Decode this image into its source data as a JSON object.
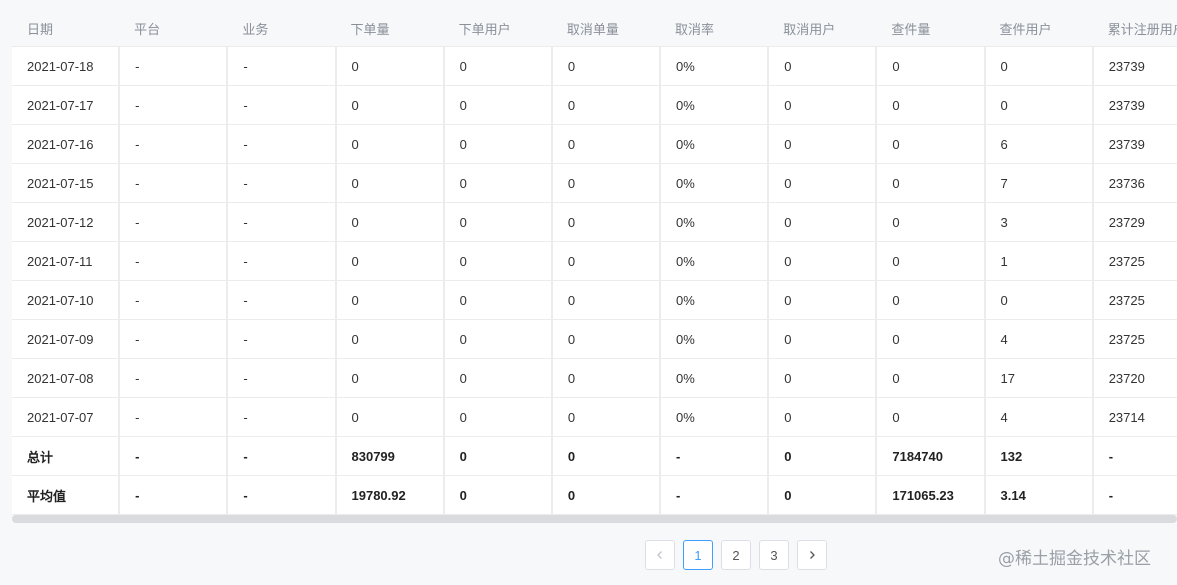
{
  "table": {
    "headers": [
      "日期",
      "平台",
      "业务",
      "下单量",
      "下单用户",
      "取消单量",
      "取消率",
      "取消用户",
      "查件量",
      "查件用户",
      "累计注册用户"
    ],
    "rows": [
      [
        "2021-07-18",
        "-",
        "-",
        "0",
        "0",
        "0",
        "0%",
        "0",
        "0",
        "0",
        "23739"
      ],
      [
        "2021-07-17",
        "-",
        "-",
        "0",
        "0",
        "0",
        "0%",
        "0",
        "0",
        "0",
        "23739"
      ],
      [
        "2021-07-16",
        "-",
        "-",
        "0",
        "0",
        "0",
        "0%",
        "0",
        "0",
        "6",
        "23739"
      ],
      [
        "2021-07-15",
        "-",
        "-",
        "0",
        "0",
        "0",
        "0%",
        "0",
        "0",
        "7",
        "23736"
      ],
      [
        "2021-07-12",
        "-",
        "-",
        "0",
        "0",
        "0",
        "0%",
        "0",
        "0",
        "3",
        "23729"
      ],
      [
        "2021-07-11",
        "-",
        "-",
        "0",
        "0",
        "0",
        "0%",
        "0",
        "0",
        "1",
        "23725"
      ],
      [
        "2021-07-10",
        "-",
        "-",
        "0",
        "0",
        "0",
        "0%",
        "0",
        "0",
        "0",
        "23725"
      ],
      [
        "2021-07-09",
        "-",
        "-",
        "0",
        "0",
        "0",
        "0%",
        "0",
        "0",
        "4",
        "23725"
      ],
      [
        "2021-07-08",
        "-",
        "-",
        "0",
        "0",
        "0",
        "0%",
        "0",
        "0",
        "17",
        "23720"
      ],
      [
        "2021-07-07",
        "-",
        "-",
        "0",
        "0",
        "0",
        "0%",
        "0",
        "0",
        "4",
        "23714"
      ]
    ],
    "summary_rows": [
      [
        "总计",
        "-",
        "-",
        "830799",
        "0",
        "0",
        "-",
        "0",
        "7184740",
        "132",
        "-"
      ],
      [
        "平均值",
        "-",
        "-",
        "19780.92",
        "0",
        "0",
        "-",
        "0",
        "171065.23",
        "3.14",
        "-"
      ]
    ]
  },
  "pagination": {
    "prev_icon": "chevron-left-icon",
    "next_icon": "chevron-right-icon",
    "pages": [
      "1",
      "2",
      "3"
    ],
    "current_page": "1"
  },
  "watermark": "@稀土掘金技术社区",
  "colors": {
    "accent": "#409eff",
    "header_text": "#8a8f99",
    "border": "#ececec"
  }
}
